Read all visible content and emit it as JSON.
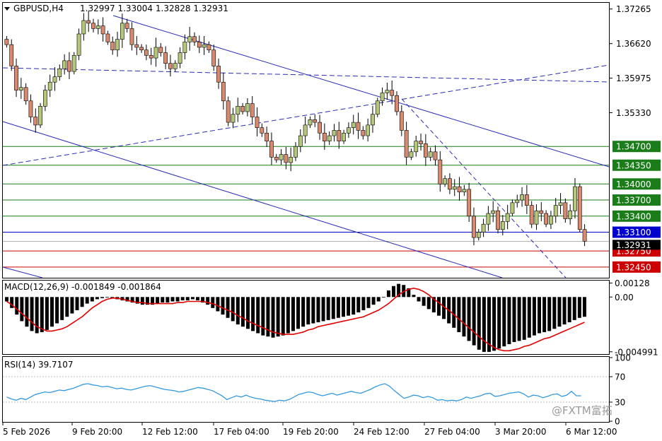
{
  "header": {
    "symbol_label": "GBPUSD,H4",
    "ohlc": "1.32997 1.33004 1.32828 1.32931"
  },
  "colors": {
    "candle_up": "#b5c77a",
    "candle_down": "#d98a6e",
    "wick": "#000000",
    "green_level": "#1a7d1a",
    "blue_level": "#0000cc",
    "red_level": "#cc0000",
    "trend": "#2b2bb5",
    "macd_signal": "#e00000",
    "rsi_line": "#3399dd",
    "current_price": "#000000"
  },
  "chart_data": [
    {
      "type": "candlestick",
      "title": "GBPUSD,H4",
      "price_axis_labels": [
        "1.37265",
        "1.36620",
        "1.35975",
        "1.35330"
      ],
      "ylim": [
        1.3225,
        1.3738
      ],
      "x_labels": [
        "5 Feb 2026",
        "9 Feb 20:00",
        "12 Feb 12:00",
        "17 Feb 04:00",
        "19 Feb 20:00",
        "24 Feb 12:00",
        "27 Feb 04:00",
        "3 Mar 20:00",
        "6 Mar 12:00"
      ],
      "horizontal_levels": [
        {
          "value": 1.347,
          "label": "1.34700",
          "color": "green"
        },
        {
          "value": 1.3435,
          "label": "1.34350",
          "color": "green"
        },
        {
          "value": 1.34,
          "label": "1.34000",
          "color": "green"
        },
        {
          "value": 1.337,
          "label": "1.33700",
          "color": "green"
        },
        {
          "value": 1.334,
          "label": "1.33400",
          "color": "green"
        },
        {
          "value": 1.331,
          "label": "1.33100",
          "color": "blue"
        },
        {
          "value": 1.3275,
          "label": "1.32750",
          "color": "red"
        },
        {
          "value": 1.3245,
          "label": "1.32450",
          "color": "red"
        }
      ],
      "current_price": {
        "value": 1.32931,
        "label": "1.32931"
      },
      "closes": [
        1.366,
        1.362,
        1.3575,
        1.358,
        1.3555,
        1.3525,
        1.351,
        1.3545,
        1.3575,
        1.359,
        1.36,
        1.3615,
        1.363,
        1.361,
        1.364,
        1.368,
        1.3705,
        1.37,
        1.369,
        1.3695,
        1.368,
        1.3665,
        1.365,
        1.367,
        1.37,
        1.369,
        1.366,
        1.3655,
        1.365,
        1.364,
        1.3635,
        1.3655,
        1.3645,
        1.3625,
        1.3615,
        1.3625,
        1.3645,
        1.3665,
        1.3675,
        1.3665,
        1.3655,
        1.366,
        1.365,
        1.362,
        1.359,
        1.3555,
        1.3515,
        1.353,
        1.3545,
        1.3535,
        1.355,
        1.3525,
        1.3505,
        1.3495,
        1.348,
        1.345,
        1.3445,
        1.3455,
        1.344,
        1.345,
        1.347,
        1.349,
        1.351,
        1.352,
        1.3515,
        1.3495,
        1.348,
        1.349,
        1.35,
        1.348,
        1.3495,
        1.3505,
        1.3515,
        1.35,
        1.349,
        1.351,
        1.353,
        1.3555,
        1.357,
        1.3575,
        1.3565,
        1.3535,
        1.35,
        1.345,
        1.346,
        1.348,
        1.3475,
        1.345,
        1.346,
        1.3445,
        1.34,
        1.341,
        1.339,
        1.3395,
        1.3385,
        1.339,
        1.334,
        1.33,
        1.331,
        1.3325,
        1.3345,
        1.335,
        1.3315,
        1.333,
        1.3345,
        1.3365,
        1.337,
        1.338,
        1.336,
        1.3325,
        1.335,
        1.3345,
        1.3325,
        1.334,
        1.336,
        1.3365,
        1.3335,
        1.335,
        1.3395,
        1.3315,
        1.3293
      ],
      "macd": {
        "label": "MACD(12,26,9) -0.001849 -0.001864",
        "axis_labels": [
          "0.00128",
          "0.00",
          "-0.004991"
        ],
        "ylim": [
          -0.0052,
          0.0015
        ],
        "histogram": [
          -0.0004,
          -0.001,
          -0.0016,
          -0.0022,
          -0.0027,
          -0.0031,
          -0.0033,
          -0.0032,
          -0.003,
          -0.0027,
          -0.0024,
          -0.0021,
          -0.0018,
          -0.0015,
          -0.0012,
          -0.0009,
          -0.0006,
          -0.0004,
          -0.0002,
          -0.0001,
          0.0,
          -0.0001,
          -0.0002,
          -0.0003,
          -0.0004,
          -0.0005,
          -0.0006,
          -0.0007,
          -0.0007,
          -0.0007,
          -0.0006,
          -0.0005,
          -0.0005,
          -0.0004,
          -0.0004,
          -0.0003,
          -0.0003,
          -0.0002,
          -0.0003,
          -0.0005,
          -0.0007,
          -0.001,
          -0.0013,
          -0.0016,
          -0.0019,
          -0.0022,
          -0.0025,
          -0.0027,
          -0.0029,
          -0.0031,
          -0.0033,
          -0.0035,
          -0.0036,
          -0.0037,
          -0.0036,
          -0.0035,
          -0.0033,
          -0.0031,
          -0.0029,
          -0.0027,
          -0.0025,
          -0.0024,
          -0.0023,
          -0.0022,
          -0.0021,
          -0.002,
          -0.0019,
          -0.0018,
          -0.0017,
          -0.0016,
          -0.0014,
          -0.0012,
          -0.001,
          -0.0007,
          -0.0004,
          0.0,
          0.0006,
          0.001,
          0.0012,
          0.0011,
          0.0008,
          0.0002,
          -0.0004,
          -0.0008,
          -0.0011,
          -0.0014,
          -0.0017,
          -0.002,
          -0.0024,
          -0.0028,
          -0.0032,
          -0.0036,
          -0.004,
          -0.0044,
          -0.0048,
          -0.005,
          -0.005,
          -0.0049,
          -0.0047,
          -0.0045,
          -0.0043,
          -0.0041,
          -0.004,
          -0.0039,
          -0.0037,
          -0.0035,
          -0.0033,
          -0.0032,
          -0.0031,
          -0.0029,
          -0.0027,
          -0.0025,
          -0.0023,
          -0.0021,
          -0.0019,
          -0.0018
        ],
        "signal": [
          -0.0004,
          -0.0007,
          -0.0011,
          -0.0015,
          -0.0019,
          -0.0023,
          -0.0027,
          -0.0029,
          -0.0031,
          -0.0031,
          -0.003,
          -0.0029,
          -0.0027,
          -0.0024,
          -0.0021,
          -0.0018,
          -0.0014,
          -0.001,
          -0.0007,
          -0.0004,
          -0.0002,
          -0.0001,
          -0.0001,
          -0.0002,
          -0.0003,
          -0.0004,
          -0.0005,
          -0.0005,
          -0.0006,
          -0.0006,
          -0.0006,
          -0.0006,
          -0.0006,
          -0.0006,
          -0.0005,
          -0.0005,
          -0.0004,
          -0.0004,
          -0.0004,
          -0.0004,
          -0.0005,
          -0.0006,
          -0.0008,
          -0.001,
          -0.0012,
          -0.0014,
          -0.0017,
          -0.0019,
          -0.0022,
          -0.0024,
          -0.0026,
          -0.0028,
          -0.003,
          -0.0032,
          -0.0033,
          -0.0034,
          -0.0034,
          -0.0034,
          -0.0033,
          -0.0032,
          -0.003,
          -0.0029,
          -0.0027,
          -0.0026,
          -0.0025,
          -0.0024,
          -0.0023,
          -0.0022,
          -0.0021,
          -0.002,
          -0.0019,
          -0.0018,
          -0.0016,
          -0.0014,
          -0.0012,
          -0.0009,
          -0.0006,
          -0.0002,
          0.0002,
          0.0005,
          0.0007,
          0.0008,
          0.0007,
          0.0005,
          0.0002,
          -0.0002,
          -0.0005,
          -0.0009,
          -0.0012,
          -0.0016,
          -0.002,
          -0.0024,
          -0.0028,
          -0.0032,
          -0.0036,
          -0.004,
          -0.0043,
          -0.0046,
          -0.0048,
          -0.0049,
          -0.0049,
          -0.0048,
          -0.0047,
          -0.0045,
          -0.0044,
          -0.0042,
          -0.004,
          -0.0038,
          -0.0037,
          -0.0035,
          -0.0033,
          -0.0031,
          -0.0029,
          -0.0027,
          -0.0025,
          -0.0023
        ]
      },
      "rsi": {
        "label": "RSI(14) 39.7107",
        "axis_labels": [
          "100",
          "70",
          "30",
          "0"
        ],
        "ylim": [
          0,
          100
        ],
        "levels": [
          70,
          30
        ],
        "values": [
          38,
          35,
          33,
          36,
          34,
          38,
          42,
          44,
          46,
          45,
          47,
          49,
          48,
          50,
          52,
          55,
          58,
          59,
          57,
          56,
          54,
          55,
          53,
          51,
          52,
          50,
          49,
          51,
          53,
          55,
          56,
          54,
          52,
          50,
          49,
          48,
          46,
          47,
          49,
          51,
          53,
          52,
          50,
          48,
          44,
          40,
          34,
          37,
          40,
          38,
          41,
          38,
          36,
          35,
          33,
          32,
          31,
          33,
          32,
          34,
          38,
          42,
          44,
          46,
          45,
          42,
          40,
          42,
          44,
          41,
          43,
          45,
          47,
          45,
          44,
          47,
          50,
          54,
          57,
          59,
          55,
          48,
          42,
          36,
          38,
          41,
          40,
          37,
          39,
          37,
          33,
          34,
          32,
          33,
          32,
          34,
          38,
          36,
          38,
          40,
          43,
          44,
          39,
          40,
          42,
          44,
          45,
          46,
          43,
          38,
          41,
          40,
          37,
          39,
          42,
          43,
          39,
          41,
          47,
          40,
          40
        ]
      }
    }
  ],
  "watermark_text": "@FXTM富拓"
}
